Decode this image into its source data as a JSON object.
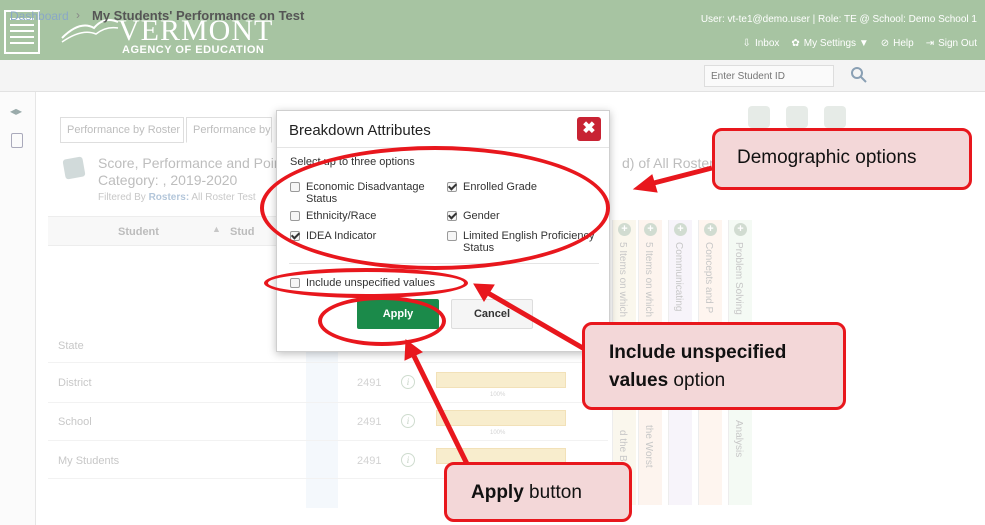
{
  "header": {
    "brand_title": "VERMONT",
    "brand_subtitle": "AGENCY OF EDUCATION",
    "user_line": "User: vt-te1@demo.user  |  Role: TE @ School: Demo School 1",
    "nav": {
      "inbox": "Inbox",
      "settings": "My Settings ▼",
      "help": "Help",
      "signout": "Sign Out"
    }
  },
  "breadcrumb": {
    "dashboard": "Dashboard",
    "separator": "›",
    "title": "My Students' Performance on Test",
    "search_placeholder": "Enter Student ID"
  },
  "tabs": {
    "tab1": "Performance by Roster",
    "tab2": "Performance by S"
  },
  "section": {
    "title_line1": "Score, Performance and Points",
    "title_line2": "Category: , 2019-2020",
    "title_right": "d) of All Rosters, b",
    "filter_prefix": "Filtered By",
    "filter_value": "Rosters:",
    "filter_rest": " All Roster",
    "filter_test": "Test"
  },
  "table": {
    "col_student": "Student",
    "sort_glyph": "▲",
    "col_student2": "Stud",
    "rows": [
      {
        "label": "State",
        "score": "",
        "pct": ""
      },
      {
        "label": "District",
        "score": "2491",
        "pct": "100%"
      },
      {
        "label": "School",
        "score": "2491",
        "pct": "100%"
      },
      {
        "label": "My Students",
        "score": "2491",
        "pct": ""
      }
    ],
    "vertical_cols": [
      {
        "text": "5 Items on which",
        "bottom": ""
      },
      {
        "text": "5 Items on which",
        "bottom": "the Worst"
      },
      {
        "text": "Communicating",
        "bottom": ""
      },
      {
        "text": "Concepts and P",
        "bottom": ""
      },
      {
        "text": "Problem Solving",
        "bottom": "Analysis"
      }
    ],
    "extra_bottom": "d the Be"
  },
  "modal": {
    "title": "Breakdown Attributes",
    "close_glyph": "✖",
    "instruction": "Select up to three options",
    "options": [
      {
        "label": "Economic Disadvantage Status",
        "checked": false
      },
      {
        "label": "Enrolled Grade",
        "checked": true
      },
      {
        "label": "Ethnicity/Race",
        "checked": false
      },
      {
        "label": "Gender",
        "checked": true
      },
      {
        "label": "IDEA Indicator",
        "checked": true
      },
      {
        "label": "Limited English Proficiency Status",
        "checked": false
      }
    ],
    "include_unspecified": "Include unspecified values",
    "apply": "Apply",
    "cancel": "Cancel"
  },
  "callouts": {
    "demographic": "Demographic options",
    "include_bold": "Include unspecified values",
    "include_tail": " option",
    "apply_bold": "Apply",
    "apply_tail": " button"
  },
  "colors": {
    "header_bg": "#a7c4a2",
    "apply_green": "#1b8a4a",
    "close_red": "#c82333",
    "annotation_red": "#e8171d",
    "callout_fill": "#f3d7d8"
  }
}
